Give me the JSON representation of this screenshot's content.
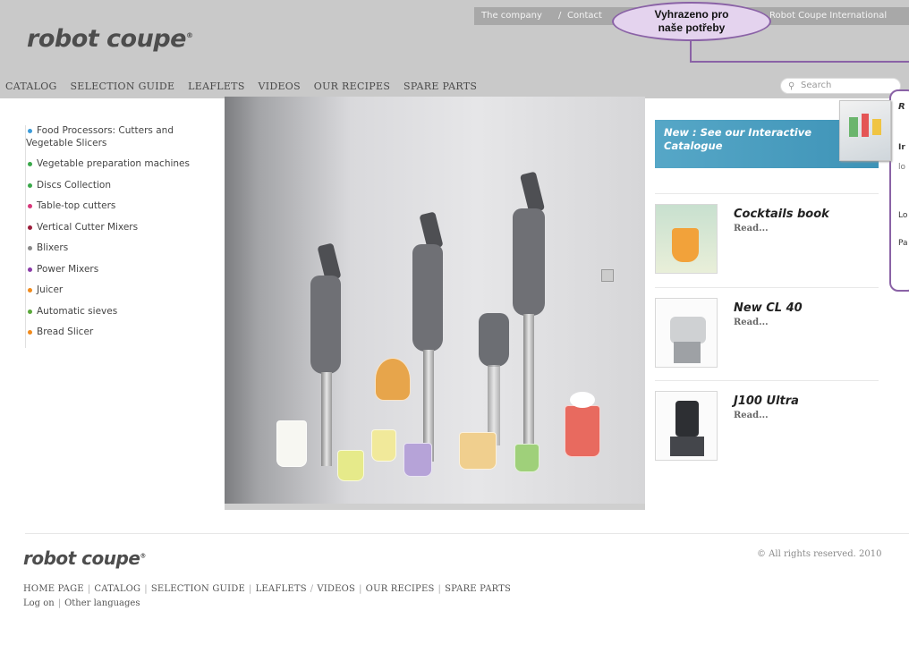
{
  "header": {
    "logo_text": "robot coupe",
    "topbar": {
      "company": "The company",
      "separator": "/",
      "contact": "Contact",
      "international": "Robot Coupe International"
    },
    "main_nav": [
      "CATALOG",
      "SELECTION GUIDE",
      "LEAFLETS",
      "VIDEOS",
      "OUR RECIPES",
      "SPARE PARTS"
    ],
    "search_placeholder": "Search"
  },
  "annotation": {
    "bubble_line1": "Vyhrazeno pro",
    "bubble_line2": "naše potřeby",
    "panel_fragments": [
      "R",
      "Ir",
      "lo",
      "Lo",
      "Pa"
    ]
  },
  "categories": [
    {
      "label": "Food Processors: Cutters and Vegetable Slicers",
      "color": "#3a9ad9"
    },
    {
      "label": "Vegetable preparation machines",
      "color": "#3aa84a"
    },
    {
      "label": "Discs Collection",
      "color": "#3aa84a"
    },
    {
      "label": "Table-top cutters",
      "color": "#d8377a"
    },
    {
      "label": "Vertical Cutter Mixers",
      "color": "#9b1c3a"
    },
    {
      "label": "Blixers",
      "color": "#8a8a8a"
    },
    {
      "label": "Power Mixers",
      "color": "#8a3aa8"
    },
    {
      "label": "Juicer",
      "color": "#f08a1c"
    },
    {
      "label": "Automatic sieves",
      "color": "#5aa83a"
    },
    {
      "label": "Bread Slicer",
      "color": "#f08a1c"
    }
  ],
  "promo": {
    "text": "New : See our Interactive Catalogue",
    "color": "#56a7c7"
  },
  "news": [
    {
      "title": "Cocktails book",
      "read": "Read..."
    },
    {
      "title": "New CL 40",
      "read": "Read..."
    },
    {
      "title": "J100 Ultra",
      "read": "Read..."
    }
  ],
  "footer": {
    "logo_text": "robot coupe",
    "copyright": "© All rights reserved. 2010",
    "nav": [
      "HOME PAGE",
      "CATALOG",
      "SELECTION GUIDE",
      "LEAFLETS",
      "VIDEOS",
      "OUR RECIPES",
      "SPARE PARTS"
    ],
    "nav2": [
      "Log on",
      "Other languages"
    ]
  }
}
